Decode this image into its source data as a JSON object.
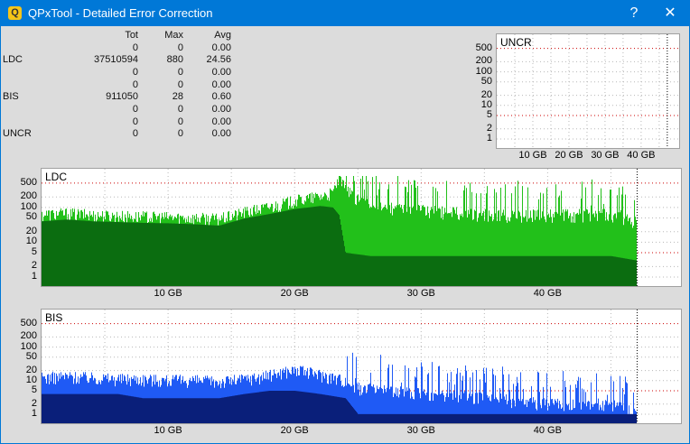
{
  "window": {
    "title": "QPxTool - Detailed Error Correction",
    "icon_letter": "Q"
  },
  "titlebar": {
    "help_glyph": "?",
    "close_glyph": "✕"
  },
  "stats": {
    "headers": [
      "",
      "Tot",
      "Max",
      "Avg"
    ],
    "rows": [
      [
        "",
        "0",
        "0",
        "0.00"
      ],
      [
        "LDC",
        "37510594",
        "880",
        "24.56"
      ],
      [
        "",
        "0",
        "0",
        "0.00"
      ],
      [
        "",
        "0",
        "0",
        "0.00"
      ],
      [
        "BIS",
        "911050",
        "28",
        "0.60"
      ],
      [
        "",
        "0",
        "0",
        "0.00"
      ],
      [
        "",
        "0",
        "0",
        "0.00"
      ],
      [
        "UNCR",
        "0",
        "0",
        "0.00"
      ]
    ]
  },
  "colors": {
    "ldc_light": "#22c01a",
    "ldc_dark": "#0b6d10",
    "bis_light": "#1f5af5",
    "bis_dark": "#0a1f7a",
    "red_grid": "#cc0000",
    "grid": "#b8b8b8"
  },
  "chart_data": [
    {
      "type": "area",
      "title": "UNCR",
      "ylabel_ticks": [
        "500",
        "200",
        "100",
        "50",
        "20",
        "10",
        "5",
        "2",
        "1"
      ],
      "xlabel_ticks": [
        "10 GB",
        "20 GB",
        "30 GB",
        "40 GB"
      ],
      "x_range_gb": [
        0,
        47
      ],
      "y_scale": "log",
      "series": []
    },
    {
      "type": "area",
      "title": "LDC",
      "ylabel_ticks": [
        "500",
        "200",
        "100",
        "50",
        "20",
        "10",
        "5",
        "2",
        "1"
      ],
      "xlabel_ticks": [
        "10 GB",
        "20 GB",
        "30 GB",
        "40 GB"
      ],
      "x_range_gb": [
        0,
        47
      ],
      "y_scale": "log",
      "series": [
        {
          "x": [
            0,
            2,
            4,
            6,
            8,
            10,
            12,
            14,
            15,
            16,
            18,
            20,
            22,
            23,
            23.5,
            24,
            26,
            30,
            35,
            40,
            45,
            47
          ],
          "y": [
            60,
            65,
            58,
            55,
            52,
            50,
            48,
            45,
            55,
            70,
            100,
            150,
            200,
            250,
            700,
            300,
            100,
            80,
            60,
            60,
            60,
            40
          ]
        },
        {
          "x": [
            0,
            2,
            4,
            6,
            8,
            10,
            12,
            14,
            15,
            16,
            18,
            20,
            22,
            23,
            23.5,
            24,
            26,
            30,
            35,
            40,
            45,
            47
          ],
          "y": [
            40,
            45,
            40,
            38,
            36,
            35,
            33,
            30,
            38,
            48,
            65,
            90,
            110,
            100,
            60,
            5,
            4,
            4,
            4,
            4,
            4,
            3
          ]
        }
      ]
    },
    {
      "type": "area",
      "title": "BIS",
      "ylabel_ticks": [
        "500",
        "200",
        "100",
        "50",
        "20",
        "10",
        "5",
        "2",
        "1"
      ],
      "xlabel_ticks": [
        "10 GB",
        "20 GB",
        "30 GB",
        "40 GB"
      ],
      "x_range_gb": [
        0,
        47
      ],
      "y_scale": "log",
      "series": [
        {
          "x": [
            0,
            2,
            4,
            6,
            8,
            10,
            12,
            14,
            16,
            18,
            19,
            20,
            22,
            24,
            25,
            30,
            35,
            40,
            45,
            47
          ],
          "y": [
            12,
            13,
            12,
            11,
            11,
            10,
            10,
            9,
            11,
            14,
            18,
            20,
            15,
            10,
            6,
            4,
            3,
            2,
            2,
            1
          ]
        },
        {
          "x": [
            0,
            2,
            4,
            6,
            8,
            10,
            12,
            14,
            16,
            18,
            20,
            22,
            24,
            25,
            30,
            40,
            47
          ],
          "y": [
            4,
            4,
            4,
            4,
            3,
            3,
            3,
            3,
            4,
            5,
            5,
            4,
            3,
            1,
            1,
            1,
            1
          ]
        }
      ]
    }
  ]
}
